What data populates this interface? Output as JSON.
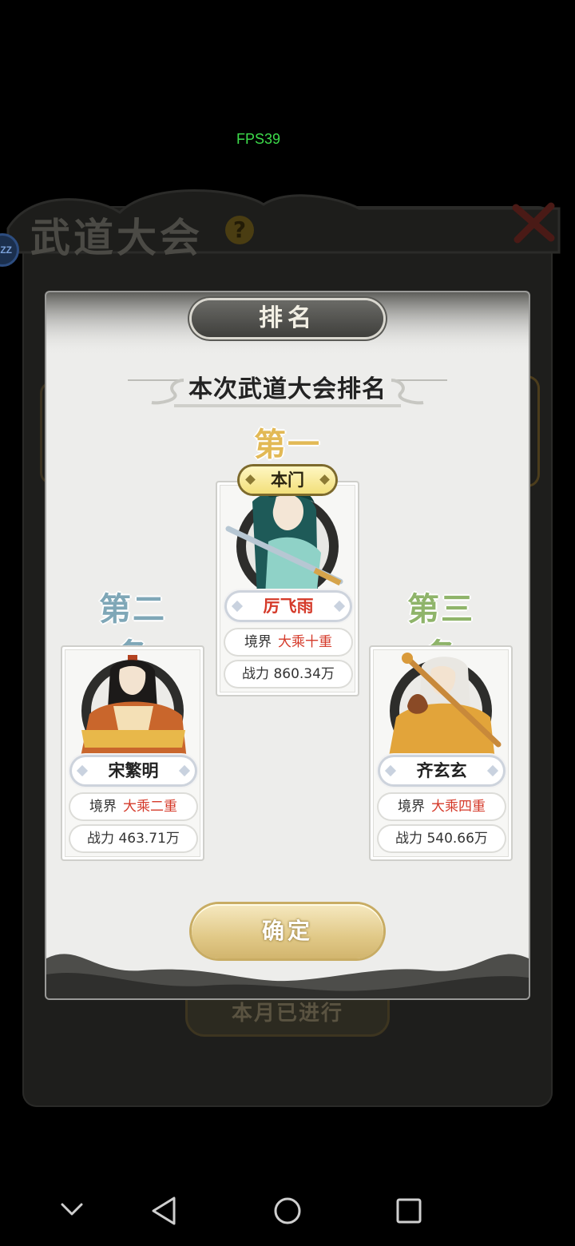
{
  "status": {
    "fps": "FPS39"
  },
  "background": {
    "title": "武道大会",
    "help_icon": "question-icon",
    "close_icon": "close-x-icon",
    "avatar_text": "ZZ",
    "month_button": "本月已进行"
  },
  "modal": {
    "title": "排名",
    "subtitle": "本次武道大会排名",
    "confirm": "确定"
  },
  "ranks": {
    "first": {
      "label": "第一名",
      "faction": "本门",
      "name": "厉飞雨",
      "realm_label": "境界",
      "realm": "大乘十重",
      "power_label": "战力",
      "power": "860.34万"
    },
    "second": {
      "label": "第二名",
      "name": "宋繁明",
      "realm_label": "境界",
      "realm": "大乘二重",
      "power_label": "战力",
      "power": "463.71万"
    },
    "third": {
      "label": "第三名",
      "name": "齐玄玄",
      "realm_label": "境界",
      "realm": "大乘四重",
      "power_label": "战力",
      "power": "540.66万"
    }
  },
  "colors": {
    "rank1": "#e2b955",
    "rank2": "#7fa7b7",
    "rank3": "#8fb46a",
    "realm_red": "#d53a2a",
    "first_name_red": "#d53a2a",
    "fps_green": "#3ddc4b"
  },
  "navbar": {
    "back": "triangle-back-icon",
    "home": "circle-home-icon",
    "recents": "square-recents-icon",
    "collapse": "chevron-down-icon"
  }
}
